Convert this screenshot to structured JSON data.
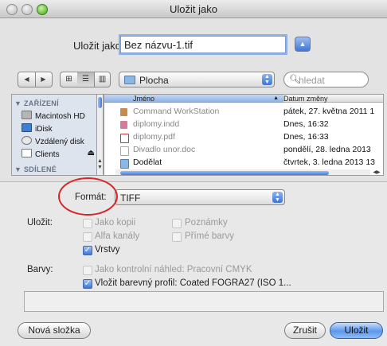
{
  "window": {
    "title": "Uložit jako"
  },
  "save_as": {
    "label": "Uložit jako:",
    "value": "Bez názvu-1.tif"
  },
  "toolbar": {
    "back": "◀",
    "forward": "▶",
    "location": "Plocha",
    "search_placeholder": "hledat"
  },
  "sidebar": {
    "section_devices": "▼ ZAŘÍZENÍ",
    "items": [
      "Macintosh HD",
      "iDisk",
      "Vzdálený disk",
      "Clients"
    ],
    "eject_glyph": "⏏",
    "section_shared": "▼ SDÍLENÉ"
  },
  "file_list": {
    "columns": [
      "Jméno",
      "Datum změny"
    ],
    "rows": [
      {
        "name": "Command WorkStation",
        "date": "pátek, 27. května 2011 1"
      },
      {
        "name": "diplomy.indd",
        "date": "Dnes, 16:32"
      },
      {
        "name": "diplomy.pdf",
        "date": "Dnes, 16:33"
      },
      {
        "name": "Divadlo unor.doc",
        "date": "pondělí, 28. ledna 2013"
      },
      {
        "name": "Dodělat",
        "date": "čtvrtek, 3. ledna 2013 13"
      }
    ]
  },
  "options": {
    "format_label": "Formát:",
    "format_value": "TIFF",
    "save_label": "Uložit:",
    "colors_label": "Barvy:",
    "checkboxes": {
      "as_copy": {
        "label": "Jako kopii",
        "checked": false
      },
      "notes": {
        "label": "Poznámky",
        "checked": false
      },
      "alpha": {
        "label": "Alfa kanály",
        "checked": false
      },
      "spot": {
        "label": "Přímé barvy",
        "checked": false
      },
      "layers": {
        "label": "Vrstvy",
        "checked": true
      },
      "proof": {
        "label": "Jako kontrolní náhled:  Pracovní CMYK",
        "checked": false
      },
      "profile": {
        "label": "Vložit barevný profil:  Coated FOGRA27 (ISO 1...",
        "checked": true
      }
    }
  },
  "buttons": {
    "new_folder": "Nová složka",
    "cancel": "Zrušit",
    "save": "Uložit"
  },
  "colors": {
    "accent": "#3f75d8",
    "highlight_circle": "#d6262a"
  }
}
